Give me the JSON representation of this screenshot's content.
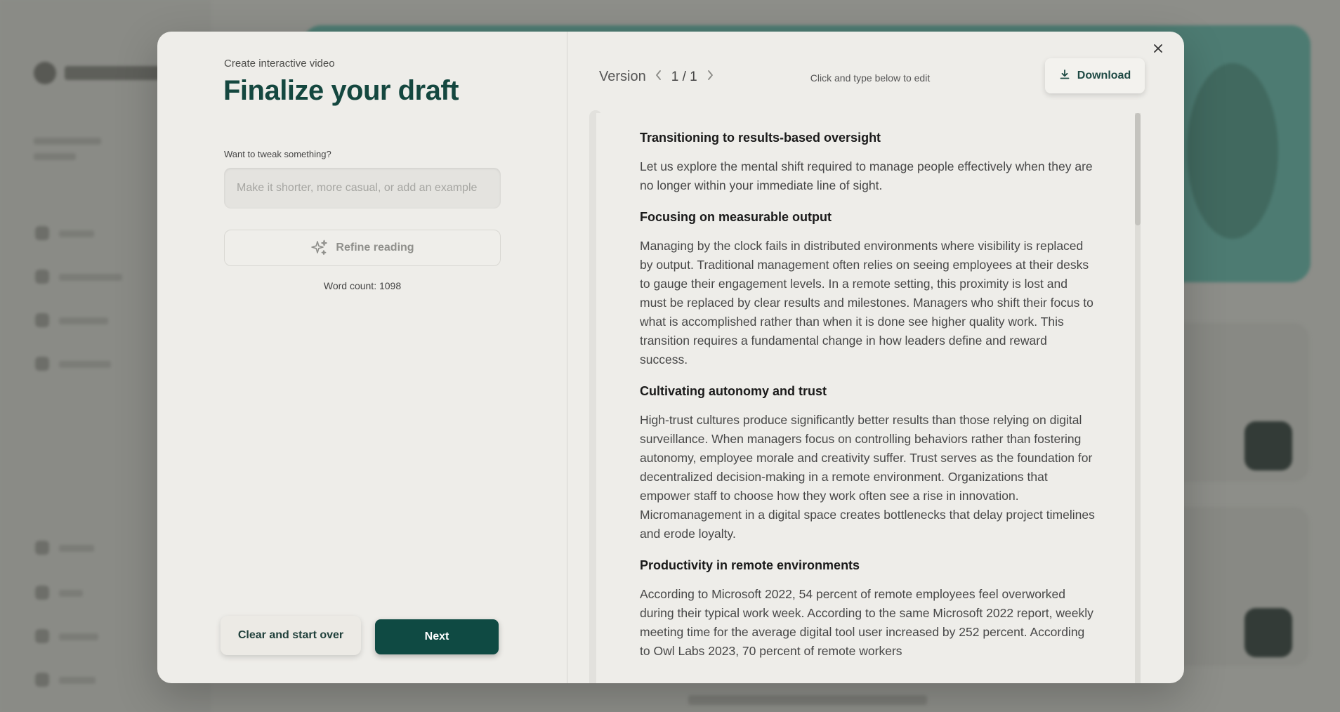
{
  "modal": {
    "eyebrow": "Create interactive video",
    "title": "Finalize your draft",
    "tweak_label": "Want to tweak something?",
    "tweak_placeholder": "Make it shorter, more casual, or add an example",
    "refine_label": "Refine reading",
    "word_count_label": "Word count: 1098",
    "clear_label": "Clear and start over",
    "next_label": "Next"
  },
  "editor": {
    "version_label": "Version",
    "version_count": "1 / 1",
    "edit_hint": "Click and type below to edit",
    "download_label": "Download",
    "sections": [
      {
        "heading": "Transitioning to results-based oversight",
        "body": "Let us explore the mental shift required to manage people effectively when they are no longer within your immediate line of sight."
      },
      {
        "heading": "Focusing on measurable output",
        "body": "Managing by the clock fails in distributed environments where visibility is replaced by output. Traditional management often relies on seeing employees at their desks to gauge their engagement levels. In a remote setting, this proximity is lost and must be replaced by clear results and milestones. Managers who shift their focus to what is accomplished rather than when it is done see higher quality work. This transition requires a fundamental change in how leaders define and reward success."
      },
      {
        "heading": "Cultivating autonomy and trust",
        "body": "High-trust cultures produce significantly better results than those relying on digital surveillance. When managers focus on controlling behaviors rather than fostering autonomy, employee morale and creativity suffer. Trust serves as the foundation for decentralized decision-making in a remote environment. Organizations that empower staff to choose how they work often see a rise in innovation. Micromanagement in a digital space creates bottlenecks that delay project timelines and erode loyalty."
      },
      {
        "heading": "Productivity in remote environments",
        "body": "According to Microsoft 2022, 54 percent of remote employees feel overworked during their typical work week. According to the same Microsoft 2022 report, weekly meeting time for the average digital tool user increased by 252 percent. According to Owl Labs 2023, 70 percent of remote workers"
      }
    ]
  },
  "icons": {
    "refine": "sparkle-icon",
    "download": "download-icon",
    "close": "close-icon",
    "prev": "chevron-left-icon",
    "next": "chevron-right-icon"
  },
  "colors": {
    "accent": "#14473f",
    "next_button": "#0f4a43",
    "modal_bg": "#eeede9",
    "overlay": "#8d8e89"
  }
}
